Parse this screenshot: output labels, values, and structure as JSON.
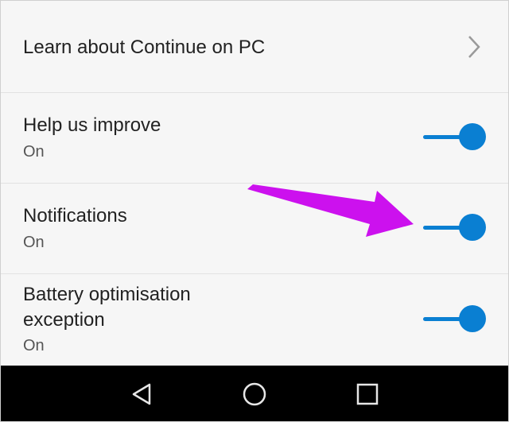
{
  "settings": {
    "items": [
      {
        "title": "Learn about Continue on PC",
        "type": "link",
        "icon": "chevron-right-icon"
      },
      {
        "title": "Help us improve",
        "status": "On",
        "type": "toggle",
        "enabled": true
      },
      {
        "title": "Notifications",
        "status": "On",
        "type": "toggle",
        "enabled": true
      },
      {
        "title_lines": [
          "Battery optimisation",
          "exception"
        ],
        "status": "On",
        "type": "toggle",
        "enabled": true
      }
    ]
  },
  "annotation": {
    "arrow_color": "#cc11ee",
    "target": "Notifications"
  },
  "accent_color": "#0a7fd2",
  "navbar": {
    "buttons": [
      {
        "name": "back",
        "icon": "back-triangle-icon"
      },
      {
        "name": "home",
        "icon": "home-circle-icon"
      },
      {
        "name": "recents",
        "icon": "recents-square-icon"
      }
    ]
  }
}
